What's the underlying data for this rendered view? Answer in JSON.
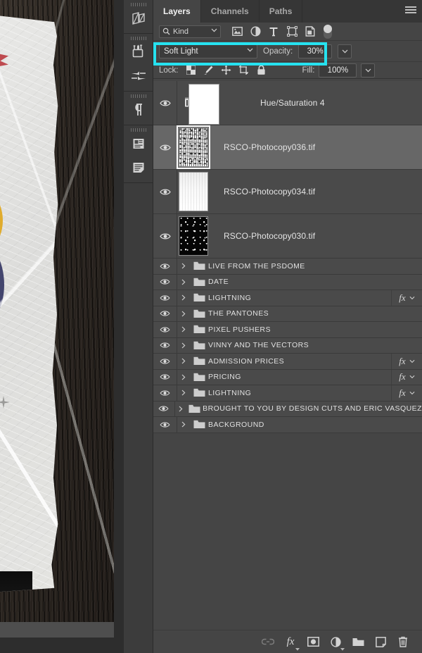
{
  "app": {
    "name": "Adobe Photoshop Layers Panel"
  },
  "canvas": {
    "artwork_alt": "Distressed gig poster on dark wood background",
    "bottom_strip": ""
  },
  "tool_rail": {
    "items": [
      {
        "name": "libraries-icon",
        "label": "Libraries"
      },
      {
        "name": "brushes-icon",
        "label": "Brushes"
      },
      {
        "name": "brush-settings-icon",
        "label": "Brush Settings"
      },
      {
        "name": "paragraph-icon",
        "label": "Paragraph"
      },
      {
        "name": "character-styles-icon",
        "label": "Character Styles"
      },
      {
        "name": "paragraph-styles-icon",
        "label": "Paragraph Styles"
      }
    ]
  },
  "panel": {
    "tabs": [
      {
        "label": "Layers",
        "active": true
      },
      {
        "label": "Channels",
        "active": false
      },
      {
        "label": "Paths",
        "active": false
      }
    ],
    "menu_icon": "hamburger-menu-icon",
    "filter": {
      "kind_label": "Kind",
      "search_icon": "search-icon",
      "icons": [
        "filter-pixel-icon",
        "filter-adjustment-icon",
        "filter-type-icon",
        "filter-shape-icon",
        "filter-smart-object-icon"
      ],
      "toggle_on": false
    },
    "blend": {
      "mode": "Soft Light",
      "opacity_label": "Opacity:",
      "opacity_value": "30%",
      "highlight_color": "#26E2F0"
    },
    "lock": {
      "label": "Lock:",
      "icons": [
        "lock-transparent-pixels-icon",
        "lock-image-pixels-icon",
        "lock-position-icon",
        "lock-artboard-nesting-icon",
        "lock-all-icon"
      ],
      "fill_label": "Fill:",
      "fill_value": "100%"
    },
    "layers": [
      {
        "name": "Hue/Saturation 4",
        "type": "adjustment",
        "visible": true,
        "selected": false,
        "has_fx": false,
        "thumb": "hue-saturation-adjustment-icon",
        "link_icon": "mask-link-icon",
        "mask": "white-layer-mask"
      },
      {
        "name": "RSCO-Photocopy036.tif",
        "type": "pixel",
        "visible": true,
        "selected": true,
        "has_fx": false,
        "thumb": "thumb-noise-light"
      },
      {
        "name": "RSCO-Photocopy034.tif",
        "type": "pixel",
        "visible": true,
        "selected": false,
        "has_fx": false,
        "thumb": "thumb-noise-pale"
      },
      {
        "name": "RSCO-Photocopy030.tif",
        "type": "pixel",
        "visible": true,
        "selected": false,
        "has_fx": false,
        "thumb": "thumb-noise-dark"
      },
      {
        "name": "LIVE FROM THE PSDOME",
        "type": "group",
        "visible": true,
        "selected": false,
        "has_fx": false
      },
      {
        "name": "DATE",
        "type": "group",
        "visible": true,
        "selected": false,
        "has_fx": false
      },
      {
        "name": "LIGHTNING",
        "type": "group",
        "visible": true,
        "selected": false,
        "has_fx": true
      },
      {
        "name": "THE PANTONES",
        "type": "group",
        "visible": true,
        "selected": false,
        "has_fx": false
      },
      {
        "name": "PIXEL PUSHERS",
        "type": "group",
        "visible": true,
        "selected": false,
        "has_fx": false
      },
      {
        "name": "VINNY AND THE VECTORS",
        "type": "group",
        "visible": true,
        "selected": false,
        "has_fx": false
      },
      {
        "name": "ADMISSION PRICES",
        "type": "group",
        "visible": true,
        "selected": false,
        "has_fx": true
      },
      {
        "name": "PRICING",
        "type": "group",
        "visible": true,
        "selected": false,
        "has_fx": true
      },
      {
        "name": "LIGHTNING",
        "type": "group",
        "visible": true,
        "selected": false,
        "has_fx": true
      },
      {
        "name": "BROUGHT TO YOU BY DESIGN CUTS AND ERIC VASQUEZ",
        "type": "group",
        "visible": true,
        "selected": false,
        "has_fx": false
      },
      {
        "name": "BACKGROUND",
        "type": "group",
        "visible": true,
        "selected": false,
        "has_fx": false
      }
    ],
    "footer_buttons": [
      {
        "name": "link-layers-button",
        "icon": "link-icon",
        "disabled": true
      },
      {
        "name": "layer-style-button",
        "icon": "fx-icon",
        "disabled": false
      },
      {
        "name": "add-layer-mask-button",
        "icon": "mask-icon",
        "disabled": false
      },
      {
        "name": "new-adjustment-layer-button",
        "icon": "adjustment-icon",
        "disabled": false
      },
      {
        "name": "new-group-button",
        "icon": "folder-icon",
        "disabled": false
      },
      {
        "name": "new-layer-button",
        "icon": "new-layer-icon",
        "disabled": false
      },
      {
        "name": "delete-layer-button",
        "icon": "trash-icon",
        "disabled": false
      }
    ]
  },
  "colors": {
    "panel_bg": "#454545",
    "row_bg": "#4a4a4a",
    "row_selected_bg": "#676767",
    "tabbar_bg": "#363636",
    "highlight": "#26E2F0"
  }
}
